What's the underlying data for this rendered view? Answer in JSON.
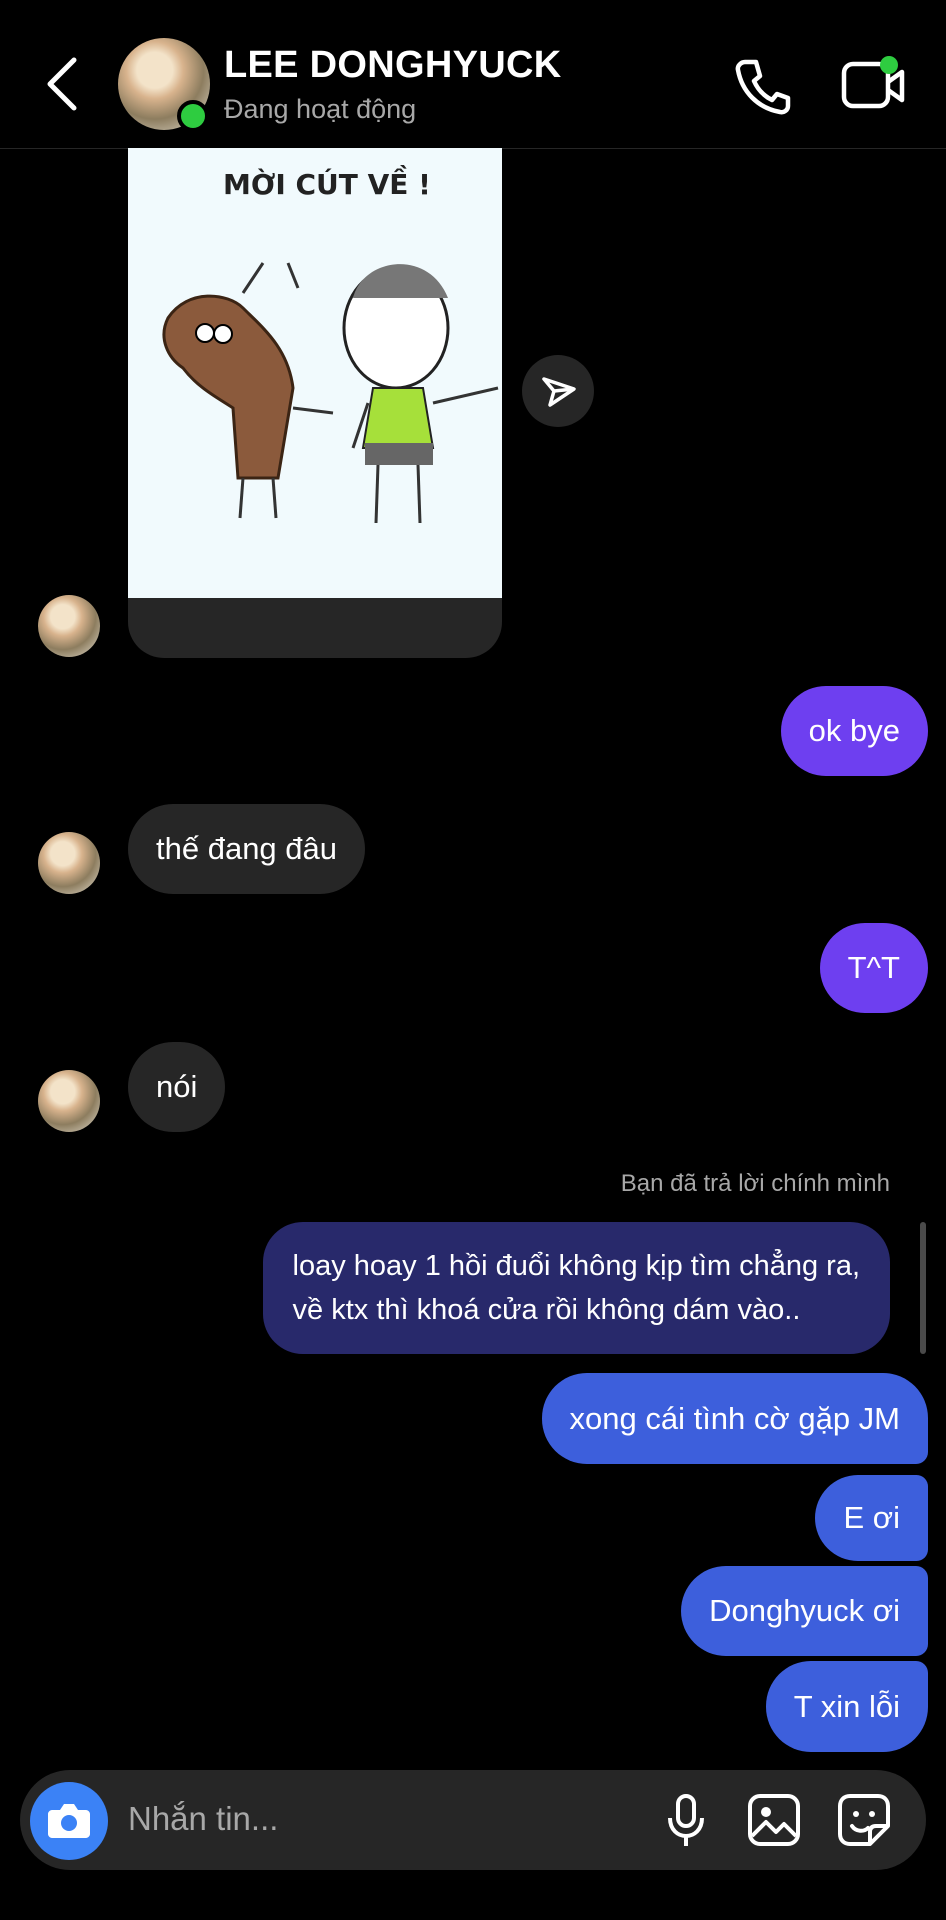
{
  "header": {
    "name": "LEE DONGHYUCK",
    "status": "Đang hoạt động"
  },
  "image_message": {
    "caption": "MỜI CÚT VỀ !"
  },
  "messages": [
    {
      "side": "sent",
      "text": "ok bye"
    },
    {
      "side": "received",
      "text": "thế đang đâu"
    },
    {
      "side": "sent",
      "text": "T^T"
    },
    {
      "side": "received",
      "text": "nói"
    }
  ],
  "reply": {
    "label": "Bạn đã trả lời chính mình",
    "quoted_line1": "loay hoay 1 hồi đuổi không kịp tìm chẳng ra,",
    "quoted_line2": "về ktx thì khoá cửa rồi không dám vào.."
  },
  "sent_group": [
    "xong cái tình cờ gặp JM",
    "E ơi",
    "Donghyuck ơi",
    "T xin lỗi"
  ],
  "composer": {
    "placeholder": "Nhắn tin..."
  },
  "icons": {
    "back": "chevron-left-icon",
    "call": "phone-icon",
    "video": "video-camera-icon",
    "share": "send-icon",
    "camera": "camera-icon",
    "mic": "microphone-icon",
    "gallery": "image-icon",
    "sticker": "sticker-icon"
  },
  "colors": {
    "online": "#2ecc40",
    "sent_purple": "#6e3ff0",
    "sent_blue": "#3d5fdc",
    "received": "#262626",
    "camera_button": "#3b82f6"
  }
}
